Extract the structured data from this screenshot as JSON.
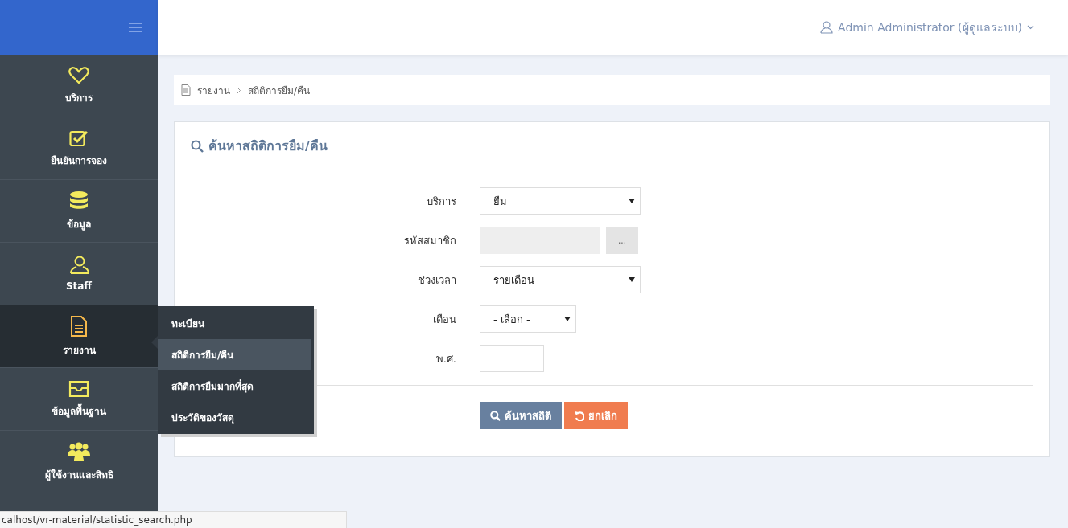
{
  "user_menu": {
    "name": "Admin Administrator (ผู้ดูแลระบบ)"
  },
  "sidebar": {
    "items": [
      {
        "label": "บริการ",
        "selected": false
      },
      {
        "label": "ยืนยันการจอง",
        "selected": false
      },
      {
        "label": "ข้อมูล",
        "selected": false
      },
      {
        "label": "Staff",
        "selected": false
      },
      {
        "label": "รายงาน",
        "selected": true
      },
      {
        "label": "ข้อมูลพื้นฐาน",
        "selected": false
      },
      {
        "label": "ผู้ใช้งานและสิทธิ",
        "selected": false
      },
      {
        "selected": false
      }
    ]
  },
  "submenu": {
    "items": [
      {
        "label": "ทะเบียน",
        "selected": false
      },
      {
        "label": "สถิติการยืม/คืน",
        "selected": true
      },
      {
        "label": "สถิติการยืมมากที่สุด",
        "selected": false
      },
      {
        "label": "ประวัติของวัสดุ",
        "selected": false
      }
    ]
  },
  "breadcrumb": [
    "รายงาน",
    "สถิติการยืม/คืน"
  ],
  "panel": {
    "title": "ค้นหาสถิติการยืม/คืน",
    "fields": [
      {
        "kind": "select",
        "label": "บริการ",
        "value": "ยืม"
      },
      {
        "kind": "lookup",
        "label": "รหัสสมาชิก",
        "button": "..."
      },
      {
        "kind": "select",
        "label": "ช่วงเวลา",
        "value": "รายเดือน"
      },
      {
        "kind": "short_select",
        "label": "เดือน",
        "value": "- เลือก -"
      },
      {
        "kind": "text",
        "label": "พ.ศ."
      }
    ],
    "buttons": [
      {
        "kind": "primary",
        "label": "ค้นหาสถิติ"
      },
      {
        "kind": "cancel",
        "label": "ยกเลิก"
      }
    ]
  },
  "status_bar": {
    "url": "calhost/vr-material/statistic_search.php"
  }
}
